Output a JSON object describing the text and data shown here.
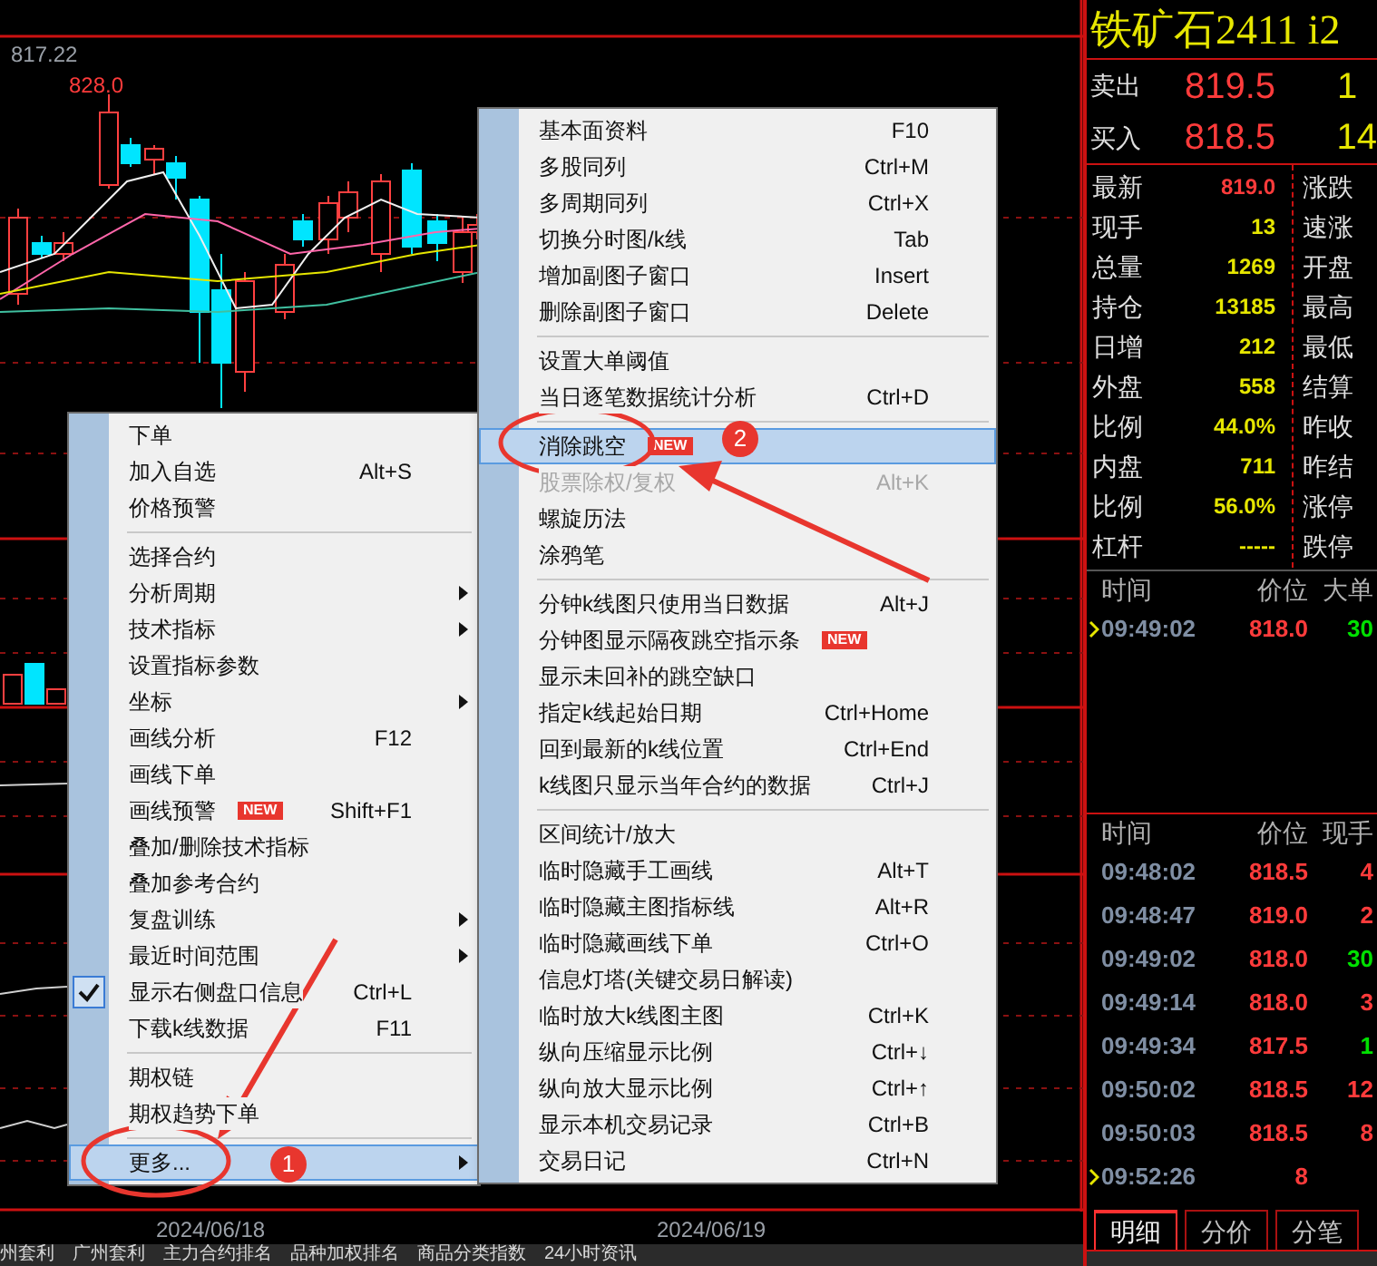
{
  "chart": {
    "price_label": "817.22",
    "high_label": "828.0",
    "dates": [
      "2024/06/18",
      "2024/06/19"
    ]
  },
  "bottom_links": [
    "州套利",
    "广州套利",
    "主力合约排名",
    "品种加权排名",
    "商品分类指数",
    "24小时资讯"
  ],
  "quote_panel": {
    "title": "铁矿石2411 i2",
    "sell": {
      "label": "卖出",
      "price": "819.5",
      "volume": "1"
    },
    "buy": {
      "label": "买入",
      "price": "818.5",
      "volume": "14"
    },
    "stats": [
      {
        "label": "最新",
        "value": "819.0",
        "color": "#ff3b3b",
        "label_2": "涨跌"
      },
      {
        "label": "现手",
        "value": "13",
        "color": "#e6e600",
        "label_2": "速涨"
      },
      {
        "label": "总量",
        "value": "1269",
        "color": "#e6e600",
        "label_2": "开盘"
      },
      {
        "label": "持仓",
        "value": "13185",
        "color": "#e6e600",
        "label_2": "最高"
      },
      {
        "label": "日增",
        "value": "212",
        "color": "#e6e600",
        "label_2": "最低"
      },
      {
        "label": "外盘",
        "value": "558",
        "color": "#e6e600",
        "label_2": "结算"
      },
      {
        "label": "比例",
        "value": "44.0%",
        "color": "#e6e600",
        "label_2": "昨收"
      },
      {
        "label": "内盘",
        "value": "711",
        "color": "#e6e600",
        "label_2": "昨结"
      },
      {
        "label": "比例",
        "value": "56.0%",
        "color": "#e6e600",
        "label_2": "涨停"
      },
      {
        "label": "杠杆",
        "value": "-----",
        "color": "#e6e600",
        "label_2": "跌停"
      }
    ],
    "big_orders": {
      "columns": [
        "时间",
        "价位",
        "大单"
      ],
      "rows": [
        {
          "time": "09:49:02",
          "price": "818.0",
          "volume": "30",
          "color": "#00e000",
          "current": true
        }
      ]
    },
    "ticks": {
      "columns": [
        "时间",
        "价位",
        "现手"
      ],
      "rows": [
        {
          "time": "09:48:02",
          "price": "818.5",
          "volume": "4",
          "color": "#ff3b3b",
          "current": false
        },
        {
          "time": "09:48:47",
          "price": "819.0",
          "volume": "2",
          "color": "#ff3b3b",
          "current": false
        },
        {
          "time": "09:49:02",
          "price": "818.0",
          "volume": "30",
          "color": "#00e000",
          "current": false
        },
        {
          "time": "09:49:14",
          "price": "818.0",
          "volume": "3",
          "color": "#ff3b3b",
          "current": false
        },
        {
          "time": "09:49:34",
          "price": "817.5",
          "volume": "1",
          "color": "#00e000",
          "current": false
        },
        {
          "time": "09:50:02",
          "price": "818.5",
          "volume": "12",
          "color": "#ff3b3b",
          "current": false
        },
        {
          "time": "09:50:03",
          "price": "818.5",
          "volume": "8",
          "color": "#ff3b3b",
          "current": false
        },
        {
          "time": "09:52:26",
          "price": "8",
          "current": true
        }
      ]
    },
    "tabs": [
      {
        "label": "明细",
        "selected": true
      },
      {
        "label": "分价",
        "selected": false
      },
      {
        "label": "分笔",
        "selected": false
      }
    ]
  },
  "context_menu": {
    "items": [
      {
        "kind": "item",
        "label": "下单",
        "selected": false,
        "checked": false,
        "disabled": false,
        "submenu": false
      },
      {
        "kind": "item",
        "label": "加入自选",
        "shortcut": "Alt+S",
        "selected": false,
        "checked": false,
        "disabled": false,
        "submenu": false
      },
      {
        "kind": "item",
        "label": "价格预警",
        "selected": false,
        "checked": false,
        "disabled": false,
        "submenu": false
      },
      {
        "kind": "separator"
      },
      {
        "kind": "item",
        "label": "选择合约",
        "selected": false,
        "checked": false,
        "disabled": false,
        "submenu": false
      },
      {
        "kind": "item",
        "label": "分析周期",
        "selected": false,
        "checked": false,
        "disabled": false,
        "submenu": true
      },
      {
        "kind": "item",
        "label": "技术指标",
        "selected": false,
        "checked": false,
        "disabled": false,
        "submenu": true
      },
      {
        "kind": "item",
        "label": "设置指标参数",
        "selected": false,
        "checked": false,
        "disabled": false,
        "submenu": false
      },
      {
        "kind": "item",
        "label": "坐标",
        "selected": false,
        "checked": false,
        "disabled": false,
        "submenu": true
      },
      {
        "kind": "item",
        "label": "画线分析",
        "shortcut": "F12",
        "selected": false,
        "checked": false,
        "disabled": false,
        "submenu": false
      },
      {
        "kind": "item",
        "label": "画线下单",
        "selected": false,
        "checked": false,
        "disabled": false,
        "submenu": false
      },
      {
        "kind": "item",
        "label": "画线预警",
        "badge": "NEW",
        "shortcut": "Shift+F1",
        "selected": false,
        "checked": false,
        "disabled": false,
        "submenu": false
      },
      {
        "kind": "item",
        "label": "叠加/删除技术指标",
        "selected": false,
        "checked": false,
        "disabled": false,
        "submenu": false
      },
      {
        "kind": "item",
        "label": "叠加参考合约",
        "selected": false,
        "checked": false,
        "disabled": false,
        "submenu": false
      },
      {
        "kind": "item",
        "label": "复盘训练",
        "selected": false,
        "checked": false,
        "disabled": false,
        "submenu": true
      },
      {
        "kind": "item",
        "label": "最近时间范围",
        "selected": false,
        "checked": false,
        "disabled": false,
        "submenu": true
      },
      {
        "kind": "item",
        "label": "显示右侧盘口信息",
        "shortcut": "Ctrl+L",
        "selected": false,
        "checked": true,
        "disabled": false,
        "submenu": false
      },
      {
        "kind": "item",
        "label": "下载k线数据",
        "shortcut": "F11",
        "selected": false,
        "checked": false,
        "disabled": false,
        "submenu": false
      },
      {
        "kind": "separator"
      },
      {
        "kind": "item",
        "label": "期权链",
        "selected": false,
        "checked": false,
        "disabled": false,
        "submenu": false
      },
      {
        "kind": "item",
        "label": "期权趋势下单",
        "selected": false,
        "checked": false,
        "disabled": false,
        "submenu": false
      },
      {
        "kind": "separator"
      },
      {
        "kind": "item",
        "label": "更多...",
        "selected": true,
        "checked": false,
        "disabled": false,
        "submenu": true
      }
    ]
  },
  "submenu": {
    "items": [
      {
        "kind": "item",
        "label": "基本面资料",
        "shortcut": "F10",
        "selected": false,
        "disabled": false
      },
      {
        "kind": "item",
        "label": "多股同列",
        "shortcut": "Ctrl+M",
        "selected": false,
        "disabled": false
      },
      {
        "kind": "item",
        "label": "多周期同列",
        "shortcut": "Ctrl+X",
        "selected": false,
        "disabled": false
      },
      {
        "kind": "item",
        "label": "切换分时图/k线",
        "shortcut": "Tab",
        "selected": false,
        "disabled": false
      },
      {
        "kind": "item",
        "label": "增加副图子窗口",
        "shortcut": "Insert",
        "selected": false,
        "disabled": false
      },
      {
        "kind": "item",
        "label": "删除副图子窗口",
        "shortcut": "Delete",
        "selected": false,
        "disabled": false
      },
      {
        "kind": "separator"
      },
      {
        "kind": "item",
        "label": "设置大单阈值",
        "selected": false,
        "disabled": false
      },
      {
        "kind": "item",
        "label": "当日逐笔数据统计分析",
        "shortcut": "Ctrl+D",
        "selected": false,
        "disabled": false
      },
      {
        "kind": "separator"
      },
      {
        "kind": "item",
        "label": "消除跳空",
        "badge": "NEW",
        "selected": true,
        "disabled": false
      },
      {
        "kind": "item",
        "label": "股票除权/复权",
        "shortcut": "Alt+K",
        "selected": false,
        "disabled": true
      },
      {
        "kind": "item",
        "label": "螺旋历法",
        "selected": false,
        "disabled": false
      },
      {
        "kind": "item",
        "label": "涂鸦笔",
        "selected": false,
        "disabled": false
      },
      {
        "kind": "separator"
      },
      {
        "kind": "item",
        "label": "分钟k线图只使用当日数据",
        "shortcut": "Alt+J",
        "selected": false,
        "disabled": false
      },
      {
        "kind": "item",
        "label": "分钟图显示隔夜跳空指示条",
        "badge": "NEW",
        "selected": false,
        "disabled": false
      },
      {
        "kind": "item",
        "label": "显示未回补的跳空缺口",
        "selected": false,
        "disabled": false
      },
      {
        "kind": "item",
        "label": "指定k线起始日期",
        "shortcut": "Ctrl+Home",
        "selected": false,
        "disabled": false
      },
      {
        "kind": "item",
        "label": "回到最新的k线位置",
        "shortcut": "Ctrl+End",
        "selected": false,
        "disabled": false
      },
      {
        "kind": "item",
        "label": "k线图只显示当年合约的数据",
        "shortcut": "Ctrl+J",
        "selected": false,
        "disabled": false
      },
      {
        "kind": "separator"
      },
      {
        "kind": "item",
        "label": "区间统计/放大",
        "selected": false,
        "disabled": false
      },
      {
        "kind": "item",
        "label": "临时隐藏手工画线",
        "shortcut": "Alt+T",
        "selected": false,
        "disabled": false
      },
      {
        "kind": "item",
        "label": "临时隐藏主图指标线",
        "shortcut": "Alt+R",
        "selected": false,
        "disabled": false
      },
      {
        "kind": "item",
        "label": "临时隐藏画线下单",
        "shortcut": "Ctrl+O",
        "selected": false,
        "disabled": false
      },
      {
        "kind": "item",
        "label": "信息灯塔(关键交易日解读)",
        "selected": false,
        "disabled": false
      },
      {
        "kind": "item",
        "label": "临时放大k线图主图",
        "shortcut": "Ctrl+K",
        "selected": false,
        "disabled": false
      },
      {
        "kind": "item",
        "label": "纵向压缩显示比例",
        "shortcut": "Ctrl+↓",
        "selected": false,
        "disabled": false
      },
      {
        "kind": "item",
        "label": "纵向放大显示比例",
        "shortcut": "Ctrl+↑",
        "selected": false,
        "disabled": false
      },
      {
        "kind": "item",
        "label": "显示本机交易记录",
        "shortcut": "Ctrl+B",
        "selected": false,
        "disabled": false
      },
      {
        "kind": "item",
        "label": "交易日记",
        "shortcut": "Ctrl+N",
        "selected": false,
        "disabled": false
      }
    ]
  },
  "annotations": [
    {
      "label": "1"
    },
    {
      "label": "2"
    }
  ]
}
